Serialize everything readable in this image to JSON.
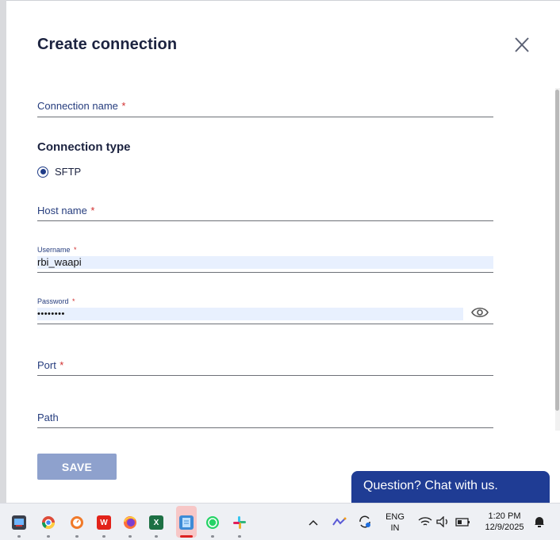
{
  "dialog": {
    "title": "Create connection",
    "close_icon": "close-icon"
  },
  "form": {
    "connection_name_label": "Connection name",
    "required_mark": "*",
    "connection_type_title": "Connection type",
    "connection_type_option": "SFTP",
    "host_name_label": "Host name",
    "username_label": "Username",
    "username_value": "rbi_waapi",
    "password_label": "Password",
    "password_value": "••••••••",
    "port_label": "Port",
    "path_label": "Path"
  },
  "footer": {
    "save_label": "SAVE"
  },
  "chat": {
    "label": "Question? Chat with us."
  },
  "taskbar": {
    "lang_top": "ENG",
    "lang_bottom": "IN",
    "time": "1:20 PM",
    "date": "12/9/2025",
    "icons": [
      "snipping-tool-icon",
      "chrome-icon",
      "clock-app-icon",
      "wps-office-icon",
      "firefox-icon",
      "excel-icon",
      "notepad-icon",
      "whatsapp-icon",
      "slack-icon"
    ]
  },
  "colors": {
    "accent": "#1f3c88",
    "save_disabled": "#8ea1cd",
    "chat_bg": "#1f3c94",
    "required": "#d12f2f",
    "autofill": "#e8f0fe"
  }
}
